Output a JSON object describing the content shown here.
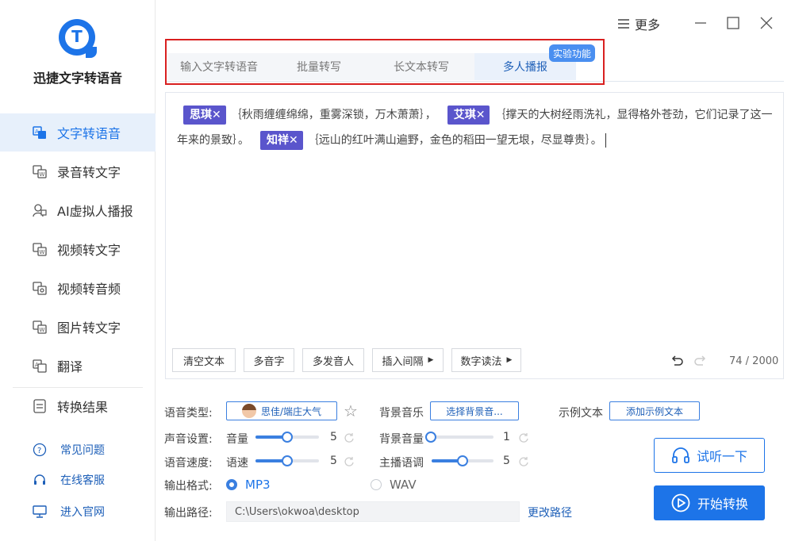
{
  "app": {
    "title": "迅捷文字转语音",
    "brand_color": "#1d74e8"
  },
  "window": {
    "more_label": "更多",
    "icons": [
      "menu-icon",
      "minimize-icon",
      "maximize-icon",
      "close-icon"
    ]
  },
  "sidebar": {
    "items": [
      {
        "label": "文字转语音",
        "icon": "text-to-speech-icon",
        "active": true
      },
      {
        "label": "录音转文字",
        "icon": "recording-to-text-icon",
        "active": false
      },
      {
        "label": "AI虚拟人播报",
        "icon": "ai-avatar-icon",
        "active": false
      },
      {
        "label": "视频转文字",
        "icon": "video-to-text-icon",
        "active": false
      },
      {
        "label": "视频转音频",
        "icon": "video-to-audio-icon",
        "active": false
      },
      {
        "label": "图片转文字",
        "icon": "image-to-text-icon",
        "active": false
      },
      {
        "label": "翻译",
        "icon": "translate-icon",
        "active": false
      },
      {
        "label": "转换结果",
        "icon": "results-icon",
        "active": false
      }
    ],
    "help": [
      {
        "label": "常见问题",
        "icon": "question-icon"
      },
      {
        "label": "在线客服",
        "icon": "headset-icon"
      },
      {
        "label": "进入官网",
        "icon": "monitor-icon"
      }
    ]
  },
  "tabs": {
    "items": [
      "输入文字转语音",
      "批量转写",
      "长文本转写",
      "多人播报"
    ],
    "active_index": 3,
    "badge": "实验功能"
  },
  "editor": {
    "segments": [
      {
        "speaker": "思琪✕",
        "text": "｛秋雨缠缠绵绵，重雾深锁，万木萧萧｝，"
      },
      {
        "speaker": "艾琪✕",
        "text": "｛撑天的大树经雨洗礼，显得格外苍劲，它们记录了这一年来的景致｝。"
      },
      {
        "speaker": "知祥✕",
        "text": "｛远山的红叶满山遍野，金色的稻田一望无垠，尽显尊贵｝。"
      }
    ],
    "toolbar": {
      "clear": "清空文本",
      "polyphone": "多音字",
      "multi_speaker": "多发音人",
      "insert_pause": "插入间隔",
      "number_reading": "数字读法",
      "dropdown_marker": "▶"
    },
    "counter": "74 / 2000"
  },
  "settings": {
    "voice_type_label": "语音类型:",
    "voice_name": "思佳/端庄大气",
    "bg_music_label": "背景音乐",
    "bg_music_button": "选择背景音...",
    "sample_text_label": "示例文本",
    "sample_text_button": "添加示例文本",
    "sound_label": "声音设置:",
    "volume_label": "音量",
    "volume_value": "5",
    "volume_level": 0.5,
    "bg_volume_label": "背景音量",
    "bg_volume_value": "1",
    "bg_volume_level": 0.0,
    "speed_label": "语音速度:",
    "speed_sub_label": "语速",
    "speed_value": "5",
    "speed_level": 0.5,
    "tone_label": "主播语调",
    "tone_value": "5",
    "tone_level": 0.5,
    "format_label": "输出格式:",
    "format_options": [
      "MP3",
      "WAV"
    ],
    "format_selected": "MP3",
    "path_label": "输出路径:",
    "path_value": "C:\\Users\\okwoa\\desktop",
    "change_path": "更改路径"
  },
  "actions": {
    "listen": "试听一下",
    "start": "开始转换"
  }
}
